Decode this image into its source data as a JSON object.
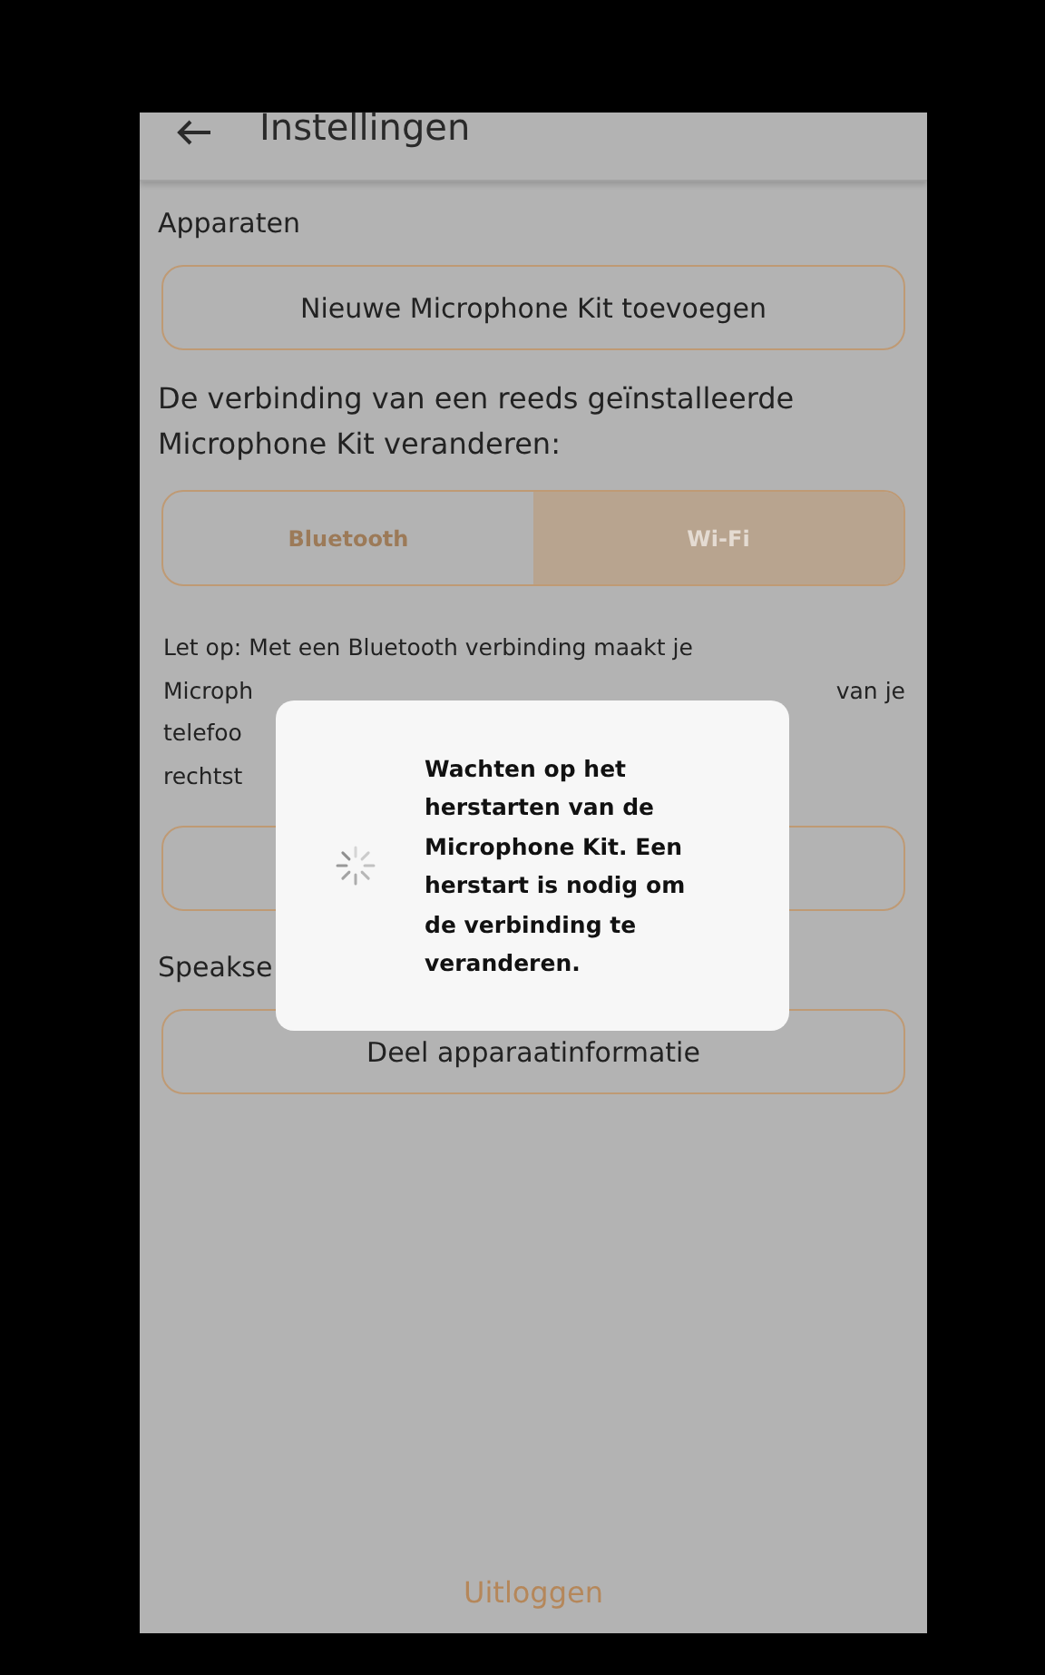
{
  "header": {
    "title": "Instellingen"
  },
  "devices_heading": "Apparaten",
  "add_button": "Nieuwe Microphone Kit toevoegen",
  "connection_prompt": "De verbinding van een reeds geïnstalleerde Microphone Kit veranderen:",
  "connection_options": [
    {
      "label": "Bluetooth",
      "selected": false
    },
    {
      "label": "Wi-Fi",
      "selected": true
    }
  ],
  "note_lines": [
    {
      "left": "Let op: Met een Bluetooth verbinding maakt je"
    },
    {
      "left": "Microph",
      "right": "van je"
    },
    {
      "left": "telefoo"
    },
    {
      "left": "rechtst"
    }
  ],
  "speakers_heading": "Speakse",
  "share_button": "Deel apparaatinformatie",
  "logout": "Uitloggen",
  "dialog": {
    "message": "Wachten op het herstarten van de Microphone Kit. Een herstart is nodig om de verbinding te veranderen."
  }
}
